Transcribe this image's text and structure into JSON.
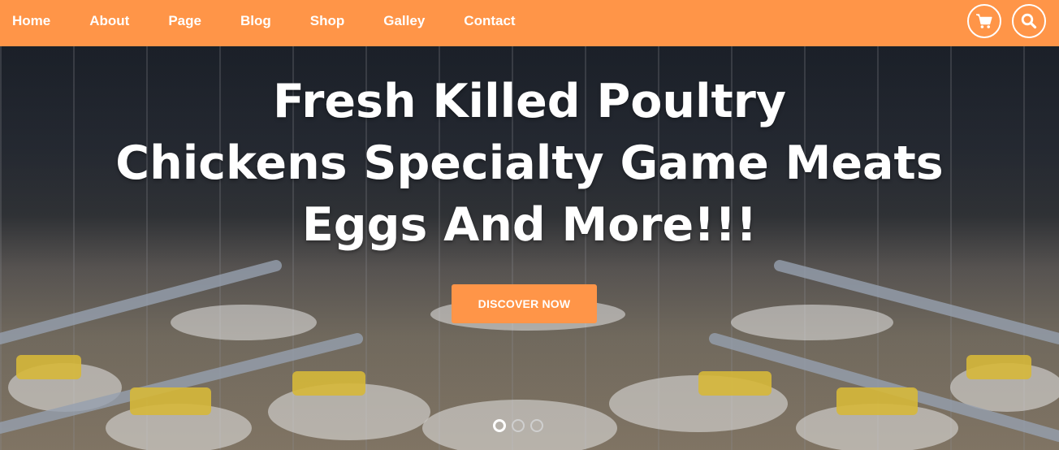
{
  "nav": {
    "links": [
      "Home",
      "About",
      "Page",
      "Blog",
      "Shop",
      "Galley",
      "Contact"
    ],
    "icons": [
      "cart-icon",
      "search-icon"
    ],
    "accent_color": "#ff9548"
  },
  "hero": {
    "title_lines": [
      "Fresh Killed Poultry",
      "Chickens Specialty Game Meats",
      "Eggs And More!!!"
    ],
    "button_label": "DISCOVER NOW",
    "slides_count": 3,
    "active_slide": 1
  }
}
